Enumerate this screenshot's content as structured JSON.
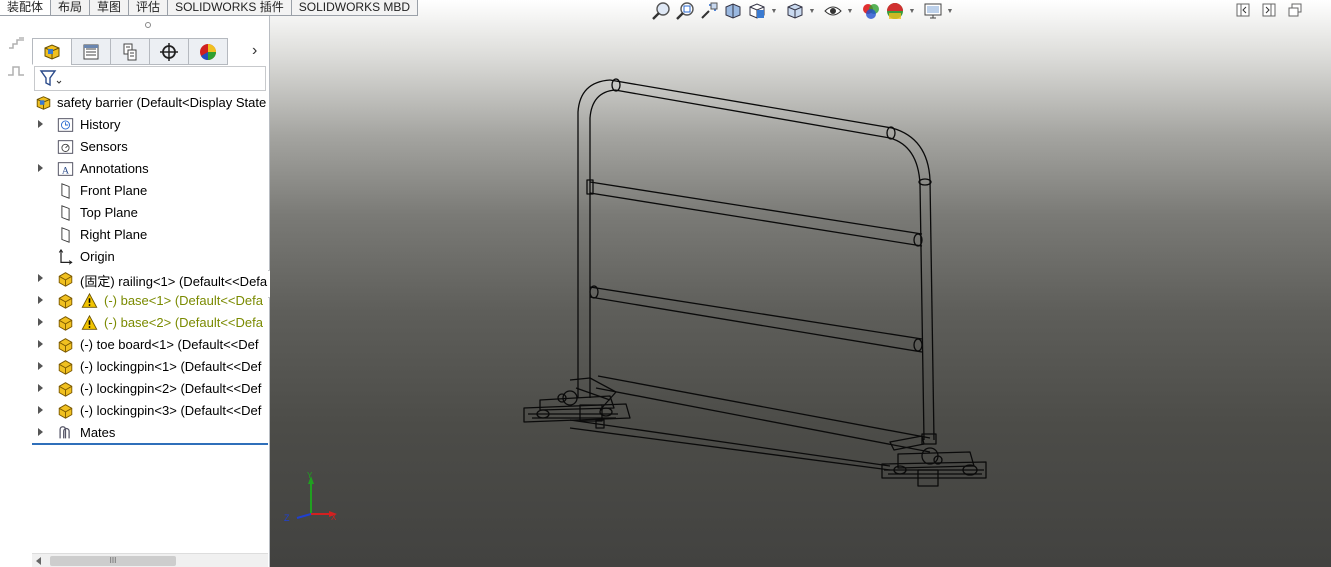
{
  "command_tabs": [
    "装配体",
    "布局",
    "草图",
    "评估",
    "SOLIDWORKS 插件",
    "SOLIDWORKS MBD"
  ],
  "feature_manager": {
    "tab_icons": [
      "featuremanager-tree-icon",
      "property-manager-icon",
      "configuration-manager-icon",
      "dimxpert-manager-icon",
      "display-manager-icon"
    ],
    "more_glyph": "›",
    "root": "safety barrier  (Default<Display State",
    "items": [
      {
        "label": "History",
        "icon": "history-icon",
        "expandable": true,
        "warning": false
      },
      {
        "label": "Sensors",
        "icon": "sensors-icon",
        "expandable": false,
        "warning": false
      },
      {
        "label": "Annotations",
        "icon": "annotations-icon",
        "expandable": true,
        "warning": false
      },
      {
        "label": "Front Plane",
        "icon": "plane-icon",
        "expandable": false,
        "warning": false
      },
      {
        "label": "Top Plane",
        "icon": "plane-icon",
        "expandable": false,
        "warning": false
      },
      {
        "label": "Right Plane",
        "icon": "plane-icon",
        "expandable": false,
        "warning": false
      },
      {
        "label": "Origin",
        "icon": "origin-icon",
        "expandable": false,
        "warning": false
      },
      {
        "label": "(固定) railing<1> (Default<<Defa",
        "icon": "part-icon",
        "expandable": true,
        "warning": false
      },
      {
        "label": "(-) base<1> (Default<<Defa",
        "icon": "part-icon",
        "expandable": true,
        "warning": true
      },
      {
        "label": "(-) base<2> (Default<<Defa",
        "icon": "part-icon",
        "expandable": true,
        "warning": true
      },
      {
        "label": "(-) toe board<1> (Default<<Def",
        "icon": "part-icon",
        "expandable": true,
        "warning": false
      },
      {
        "label": "(-) lockingpin<1> (Default<<Def",
        "icon": "part-icon",
        "expandable": true,
        "warning": false
      },
      {
        "label": "(-) lockingpin<2> (Default<<Def",
        "icon": "part-icon",
        "expandable": true,
        "warning": false
      },
      {
        "label": "(-) lockingpin<3> (Default<<Def",
        "icon": "part-icon",
        "expandable": true,
        "warning": false
      },
      {
        "label": "Mates",
        "icon": "mates-icon",
        "expandable": true,
        "warning": false
      }
    ],
    "scroll_thumb_grip": "III"
  },
  "heads_up_toolbar": [
    "zoom-to-fit-icon",
    "zoom-to-area-icon",
    "previous-view-icon",
    "section-view-icon",
    "view-orientation-icon",
    "display-style-icon",
    "hide-show-items-icon",
    "edit-appearance-icon",
    "apply-scene-icon",
    "view-settings-icon"
  ],
  "triad": {
    "y": "Y",
    "z": "Z",
    "x": "X"
  },
  "colors": {
    "warning_text": "#7a8a00",
    "tree_underline": "#2f6fba",
    "triad_x": "#d32020",
    "triad_y": "#20a020",
    "triad_z": "#2040d0",
    "part_icon": "#e8b828"
  }
}
